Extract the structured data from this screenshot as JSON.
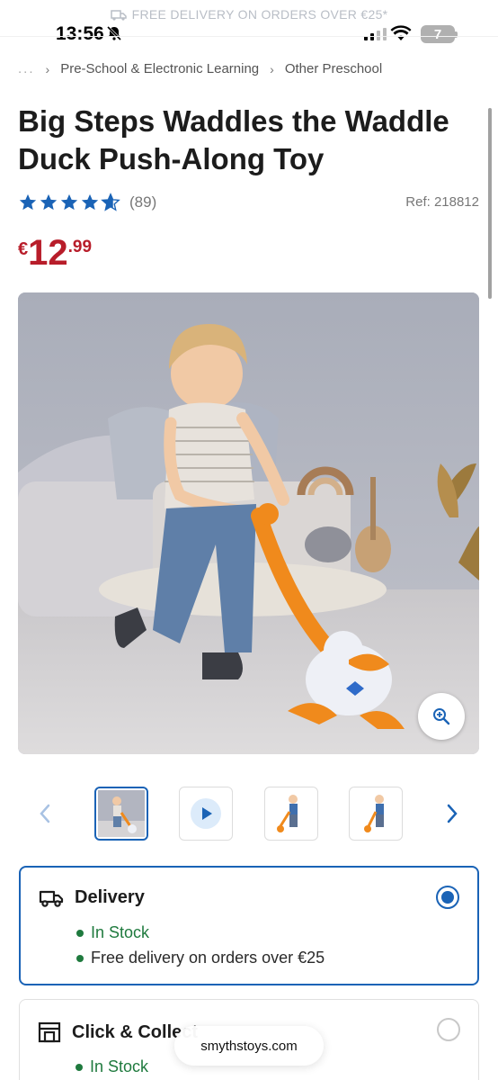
{
  "promo": {
    "text": "FREE DELIVERY ON ORDERS OVER €25*",
    "icon": "truck-icon"
  },
  "status": {
    "time": "13:56",
    "battery": "7"
  },
  "breadcrumb": {
    "ellipsis": "...",
    "items": [
      "Pre-School & Electronic Learning",
      "Other Preschool"
    ]
  },
  "product": {
    "title": "Big Steps Waddles the Waddle Duck Push-Along Toy",
    "rating_count": "(89)",
    "rating_stars": 4.5,
    "ref": "Ref: 218812",
    "price": {
      "currency": "€",
      "main": "12",
      "cents": ".99"
    }
  },
  "gallery": {
    "thumbnails": [
      "photo",
      "video",
      "photo",
      "photo"
    ],
    "selected": 0
  },
  "delivery": {
    "title": "Delivery",
    "stock": "In Stock",
    "note": "Free delivery on orders over €25"
  },
  "collect": {
    "title": "Click & Collect",
    "stock": "In Stock"
  },
  "browser": {
    "url": "smythstoys.com"
  },
  "colors": {
    "accent": "#1a63b6",
    "price": "#b81d2a",
    "stock": "#1f7a3e"
  }
}
